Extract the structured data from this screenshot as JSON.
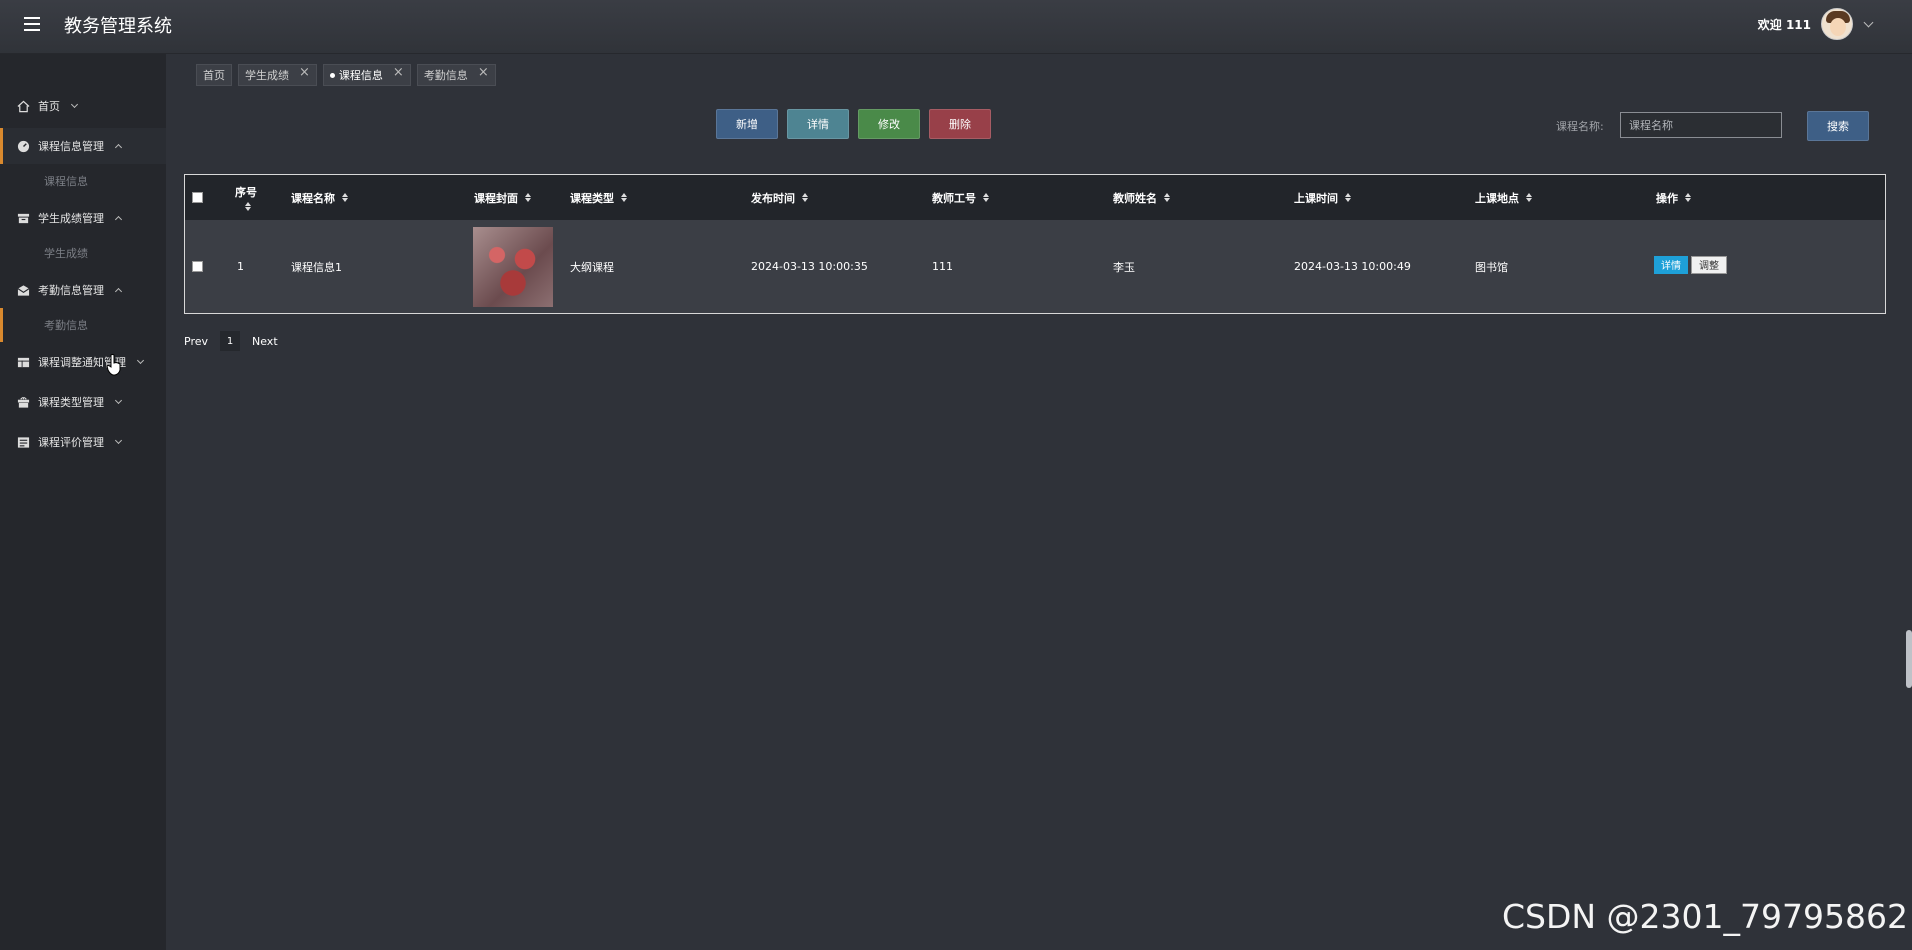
{
  "app": {
    "title": "教务管理系统"
  },
  "header": {
    "welcome": "欢迎 111"
  },
  "sidebar": {
    "items": [
      {
        "label": "首页",
        "icon": "home-icon"
      },
      {
        "label": "课程信息管理",
        "icon": "gauge-icon",
        "sub": "课程信息"
      },
      {
        "label": "学生成绩管理",
        "icon": "archive-icon",
        "sub": "学生成绩"
      },
      {
        "label": "考勤信息管理",
        "icon": "envelope-icon",
        "sub": "考勤信息"
      },
      {
        "label": "课程调整通知管理",
        "icon": "table-icon"
      },
      {
        "label": "课程类型管理",
        "icon": "gift-icon"
      },
      {
        "label": "课程评价管理",
        "icon": "list-icon"
      }
    ]
  },
  "tabs": [
    {
      "label": "首页"
    },
    {
      "label": "学生成绩"
    },
    {
      "label": "课程信息"
    },
    {
      "label": "考勤信息"
    }
  ],
  "actions": {
    "add": "新增",
    "detail": "详情",
    "edit": "修改",
    "delete": "删除"
  },
  "search": {
    "label": "课程名称:",
    "placeholder": "课程名称",
    "button": "搜索"
  },
  "table": {
    "columns": [
      "序号",
      "课程名称",
      "课程封面",
      "课程类型",
      "发布时间",
      "教师工号",
      "教师姓名",
      "上课时间",
      "上课地点",
      "操作"
    ],
    "rows": [
      {
        "index": "1",
        "name": "课程信息1",
        "type": "大纲课程",
        "published": "2024-03-13 10:00:35",
        "teacher_id": "111",
        "teacher_name": "李玉",
        "class_time": "2024-03-13 10:00:49",
        "location": "图书馆",
        "op_detail": "详情",
        "op_adjust": "调整"
      }
    ]
  },
  "pagination": {
    "prev": "Prev",
    "page": "1",
    "next": "Next"
  },
  "watermark": "CSDN @2301_79795862",
  "colors": {
    "accent": "#d9892e",
    "add": "#3e5f86",
    "detail": "#4e8492",
    "edit": "#4a8a49",
    "delete": "#984049"
  }
}
